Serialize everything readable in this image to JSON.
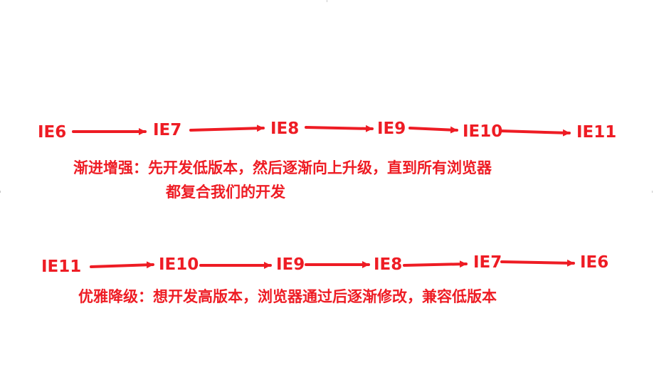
{
  "diagram": {
    "accent_color": "#ee1c24",
    "progressive": {
      "nodes": [
        "IE6",
        "IE7",
        "IE8",
        "IE9",
        "IE10",
        "IE11"
      ],
      "caption_line1": "渐进增强：先开发低版本，然后逐渐向上升级，直到所有浏览器",
      "caption_line2": "都复合我们的开发"
    },
    "graceful": {
      "nodes": [
        "IE11",
        "IE10",
        "IE9",
        "IE8",
        "IE7",
        "IE6"
      ],
      "caption": "优雅降级：想开发高版本，浏览器通过后逐渐修改，兼容低版本"
    }
  }
}
